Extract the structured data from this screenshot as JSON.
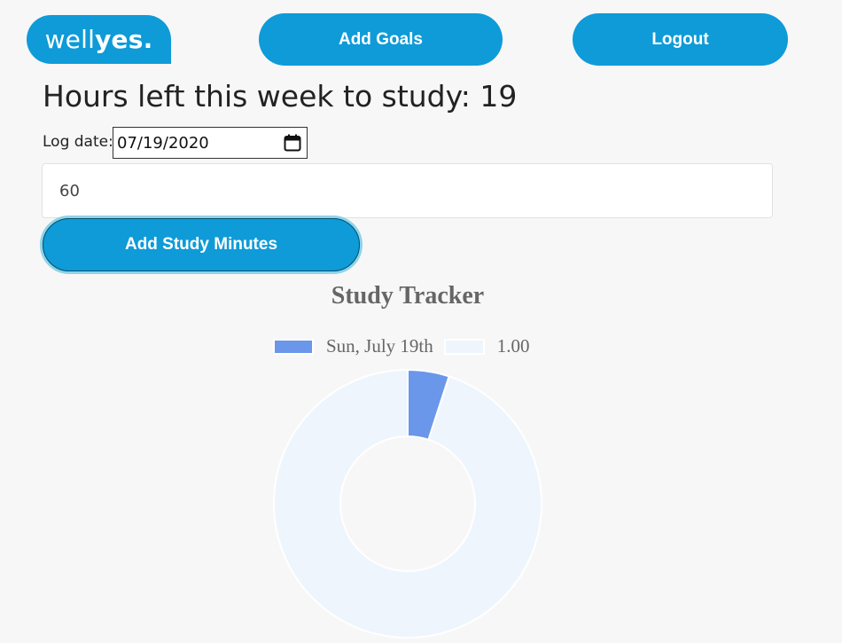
{
  "header": {
    "logo": {
      "light": "well",
      "bold": "yes."
    },
    "add_goals_label": "Add Goals",
    "logout_label": "Logout"
  },
  "main": {
    "heading": "Hours left this week to study: 19",
    "log_date_label": "Log date:",
    "log_date_value": "07/19/2020",
    "minutes_value": "60",
    "add_minutes_label": "Add Study Minutes"
  },
  "colors": {
    "brand": "#0e9bd8",
    "series_1": "#6a97ea",
    "series_2": "#eef5fd"
  },
  "chart_data": {
    "type": "pie",
    "variant": "doughnut",
    "title": "Study Tracker",
    "legend": "top",
    "labels": [
      "Sun, July 19th",
      "1.00"
    ],
    "values": [
      1,
      19
    ],
    "colors": [
      "#6a97ea",
      "#eef5fd"
    ]
  }
}
